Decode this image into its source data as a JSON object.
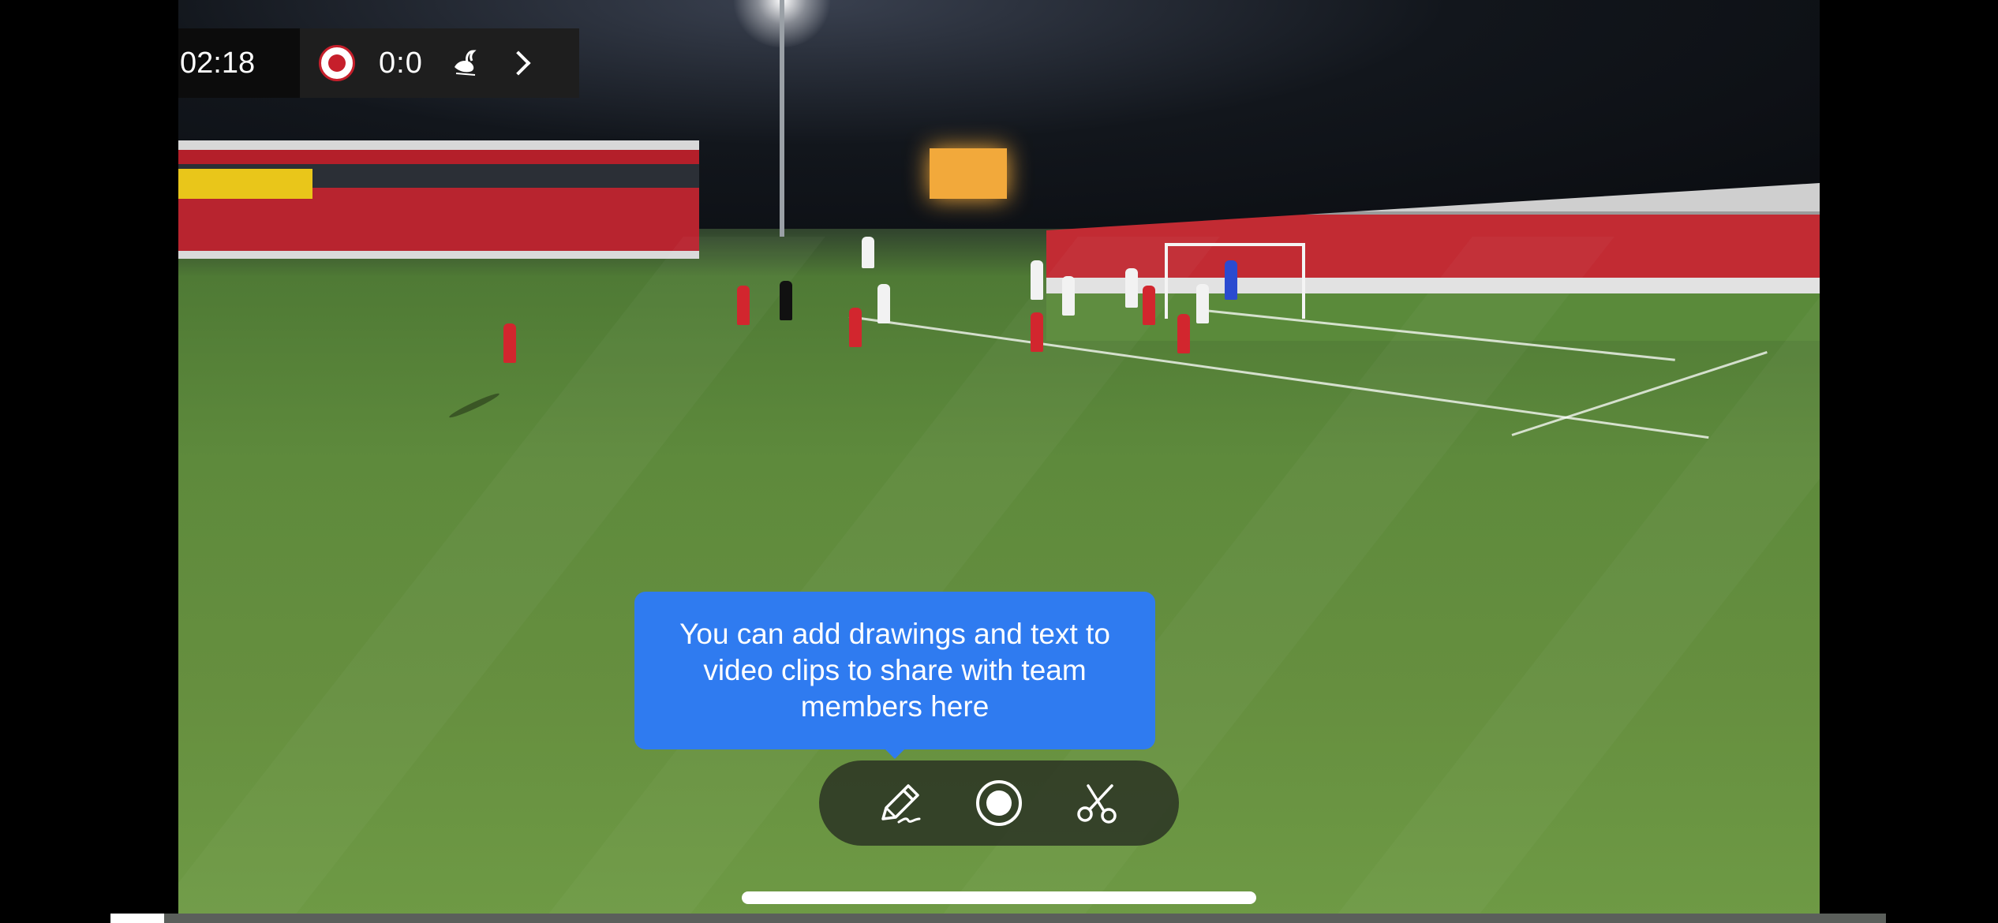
{
  "match": {
    "clock": "02:18",
    "score": "0:0",
    "home_crest": "accrington-crest-icon",
    "away_crest": "swansea-swan-icon",
    "next_icon": "chevron-right-icon"
  },
  "tooltip": {
    "text": "You can add drawings and text to video clips to share with team members here"
  },
  "toolbar": {
    "tools": [
      {
        "name": "draw",
        "icon": "pencil-icon"
      },
      {
        "name": "record",
        "icon": "record-icon"
      },
      {
        "name": "clip",
        "icon": "scissors-icon"
      }
    ]
  },
  "playback": {
    "progress": 0.03
  },
  "colors": {
    "tooltip": "#2f7bf0",
    "toolbar": "#28301f",
    "home_team": "#d2262e",
    "away_team": "#f2f2f2"
  }
}
